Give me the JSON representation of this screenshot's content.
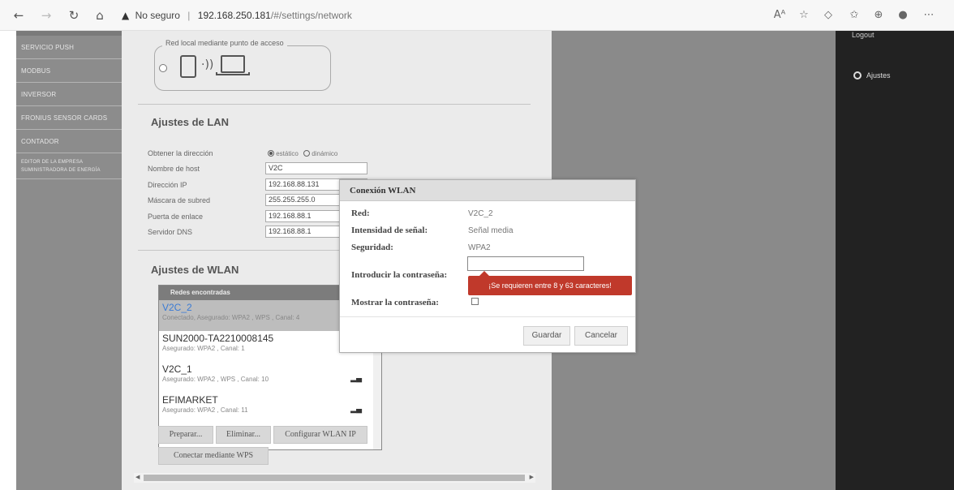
{
  "browser": {
    "security_label": "No seguro",
    "url_host": "192.168.250.181",
    "url_path": "/#/settings/network"
  },
  "sidebar": {
    "items": [
      {
        "label": "SERVICIO PUSH"
      },
      {
        "label": "MODBUS"
      },
      {
        "label": "INVERSOR"
      },
      {
        "label": "FRONIUS SENSOR CARDS"
      },
      {
        "label": "CONTADOR"
      },
      {
        "label": "EDITOR DE LA EMPRESA SUMINISTRADORA DE ENERGÍA"
      }
    ]
  },
  "rightpanel": {
    "logout": "Logout",
    "ajustes": "Ajustes"
  },
  "access_point": {
    "label": "Red local mediante punto de acceso"
  },
  "lan": {
    "title": "Ajustes de LAN",
    "labels": {
      "address": "Obtener la dirección",
      "hostname": "Nombre de host",
      "ip": "Dirección IP",
      "subnet": "Máscara de subred",
      "gateway": "Puerta de enlace",
      "dns": "Servidor DNS"
    },
    "radio_static": "estático",
    "radio_dynamic": "dinámico",
    "values": {
      "hostname": "V2C",
      "ip": "192.168.88.131",
      "subnet": "255.255.255.0",
      "gateway": "192.168.88.1",
      "dns": "192.168.88.1"
    }
  },
  "wlan": {
    "title": "Ajustes de WLAN",
    "list_header": "Redes encontradas",
    "networks": [
      {
        "name": "V2C_2",
        "info": "Conectado, Asegurado: WPA2 , WPS , Canal: 4"
      },
      {
        "name": "SUN2000-TA2210008145",
        "info": "Asegurado: WPA2 , Canal: 1"
      },
      {
        "name": "V2C_1",
        "info": "Asegurado: WPA2 , WPS , Canal: 10"
      },
      {
        "name": "EFIMARKET",
        "info": "Asegurado: WPA2 , Canal: 11"
      }
    ],
    "buttons": {
      "prepare": "Preparar...",
      "delete": "Eliminar...",
      "configure_ip": "Configurar WLAN IP",
      "wps": "Conectar mediante WPS"
    }
  },
  "modal": {
    "title": "Conexión WLAN",
    "labels": {
      "network": "Red:",
      "signal": "Intensidad de señal:",
      "security": "Seguridad:",
      "password": "Introducir la contraseña:",
      "show_password": "Mostrar la contraseña:"
    },
    "values": {
      "network": "V2C_2",
      "signal": "Señal media",
      "security": "WPA2",
      "password": ""
    },
    "error": "¡Se requieren entre 8 y 63 caracteres!",
    "save": "Guardar",
    "cancel": "Cancelar"
  }
}
